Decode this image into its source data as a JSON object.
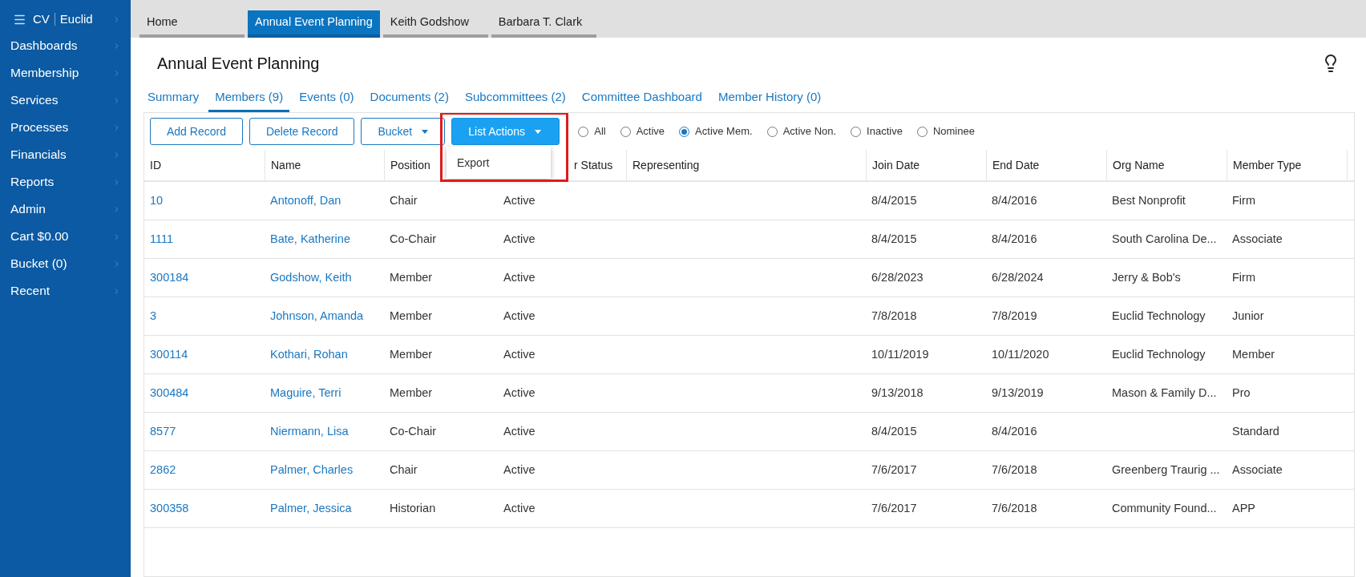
{
  "brand": {
    "left": "CV",
    "right": "Euclid"
  },
  "sidebar": {
    "items": [
      {
        "label": "Dashboards"
      },
      {
        "label": "Membership"
      },
      {
        "label": "Services"
      },
      {
        "label": "Processes"
      },
      {
        "label": "Financials"
      },
      {
        "label": "Reports"
      },
      {
        "label": "Admin"
      },
      {
        "label": "Cart $0.00"
      },
      {
        "label": "Bucket (0)"
      },
      {
        "label": "Recent"
      }
    ]
  },
  "tabs": [
    {
      "label": "Home",
      "selected": false
    },
    {
      "label": "Annual Event Planning",
      "selected": true
    },
    {
      "label": "Keith Godshow",
      "selected": false
    },
    {
      "label": "Barbara T. Clark",
      "selected": false
    }
  ],
  "page": {
    "title": "Annual Event Planning"
  },
  "subtabs": [
    {
      "label": "Summary",
      "selected": false
    },
    {
      "label": "Members (9)",
      "selected": true
    },
    {
      "label": "Events (0)",
      "selected": false
    },
    {
      "label": "Documents (2)",
      "selected": false
    },
    {
      "label": "Subcommittees (2)",
      "selected": false
    },
    {
      "label": "Committee Dashboard",
      "selected": false
    },
    {
      "label": "Member History (0)",
      "selected": false
    }
  ],
  "toolbar": {
    "buttons": [
      {
        "label": "Add Record",
        "kind": "outline"
      },
      {
        "label": "Delete Record",
        "kind": "outline"
      },
      {
        "label": "Bucket",
        "kind": "outline-dropdown"
      },
      {
        "label": "List Actions",
        "kind": "primary-dropdown"
      }
    ]
  },
  "dropdown": {
    "items": [
      "Export"
    ]
  },
  "filters": [
    {
      "label": "All",
      "selected": false
    },
    {
      "label": "Active",
      "selected": false
    },
    {
      "label": "Active Mem.",
      "selected": true
    },
    {
      "label": "Active Non.",
      "selected": false
    },
    {
      "label": "Inactive",
      "selected": false
    },
    {
      "label": "Nominee",
      "selected": false
    }
  ],
  "table": {
    "columns": [
      {
        "label": "ID",
        "kind": "link"
      },
      {
        "label": "Name",
        "kind": "link"
      },
      {
        "label": "Position",
        "kind": "text"
      },
      {
        "label": "r Status",
        "kind": "text"
      },
      {
        "label": "Representing",
        "kind": "text"
      },
      {
        "label": "Join Date",
        "kind": "text"
      },
      {
        "label": "End Date",
        "kind": "text"
      },
      {
        "label": "Org Name",
        "kind": "text"
      },
      {
        "label": "Member Type",
        "kind": "text"
      }
    ],
    "rows": [
      {
        "cells": [
          "10",
          "Antonoff, Dan",
          "Chair",
          "Active",
          "",
          "8/4/2015",
          "8/4/2016",
          "Best Nonprofit",
          "Firm"
        ]
      },
      {
        "cells": [
          "1111",
          "Bate, Katherine",
          "Co-Chair",
          "Active",
          "",
          "8/4/2015",
          "8/4/2016",
          "South Carolina De...",
          "Associate"
        ]
      },
      {
        "cells": [
          "300184",
          "Godshow, Keith",
          "Member",
          "Active",
          "",
          "6/28/2023",
          "6/28/2024",
          "Jerry & Bob's",
          "Firm"
        ]
      },
      {
        "cells": [
          "3",
          "Johnson, Amanda",
          "Member",
          "Active",
          "",
          "7/8/2018",
          "7/8/2019",
          "Euclid Technology",
          "Junior"
        ]
      },
      {
        "cells": [
          "300114",
          "Kothari, Rohan",
          "Member",
          "Active",
          "",
          "10/11/2019",
          "10/11/2020",
          "Euclid Technology",
          "Member"
        ]
      },
      {
        "cells": [
          "300484",
          "Maguire, Terri",
          "Member",
          "Active",
          "",
          "9/13/2018",
          "9/13/2019",
          "Mason & Family D...",
          "Pro"
        ]
      },
      {
        "cells": [
          "8577",
          "Niermann, Lisa",
          "Co-Chair",
          "Active",
          "",
          "8/4/2015",
          "8/4/2016",
          "",
          "Standard"
        ]
      },
      {
        "cells": [
          "2862",
          "Palmer, Charles",
          "Chair",
          "Active",
          "",
          "7/6/2017",
          "7/6/2018",
          "Greenberg Traurig ...",
          "Associate"
        ]
      },
      {
        "cells": [
          "300358",
          "Palmer, Jessica",
          "Historian",
          "Active",
          "",
          "7/6/2017",
          "7/6/2018",
          "Community Found...",
          "APP"
        ]
      }
    ]
  }
}
